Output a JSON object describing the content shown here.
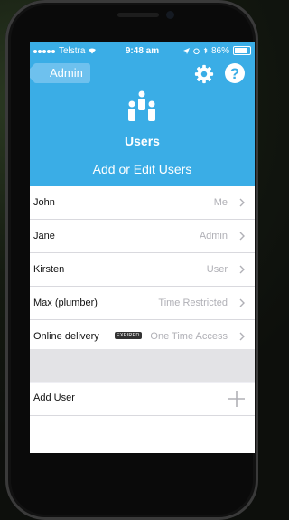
{
  "status_bar": {
    "carrier": "Telstra",
    "time": "9:48 am",
    "battery": "86%"
  },
  "header": {
    "back_label": "Admin",
    "title": "Users",
    "subtitle": "Add or Edit Users",
    "icons": [
      "gear-icon",
      "help-icon",
      "users-icon"
    ],
    "accent_color": "#3aade6"
  },
  "users": [
    {
      "name": "John",
      "role": "Me"
    },
    {
      "name": "Jane",
      "role": "Admin"
    },
    {
      "name": "Kirsten",
      "role": "User"
    },
    {
      "name": "Max (plumber)",
      "role": "Time Restricted"
    },
    {
      "name": "Online delivery",
      "role": "One Time Access",
      "badge": "EXPIRED"
    }
  ],
  "add_user": {
    "label": "Add User",
    "icon": "plus-icon"
  }
}
